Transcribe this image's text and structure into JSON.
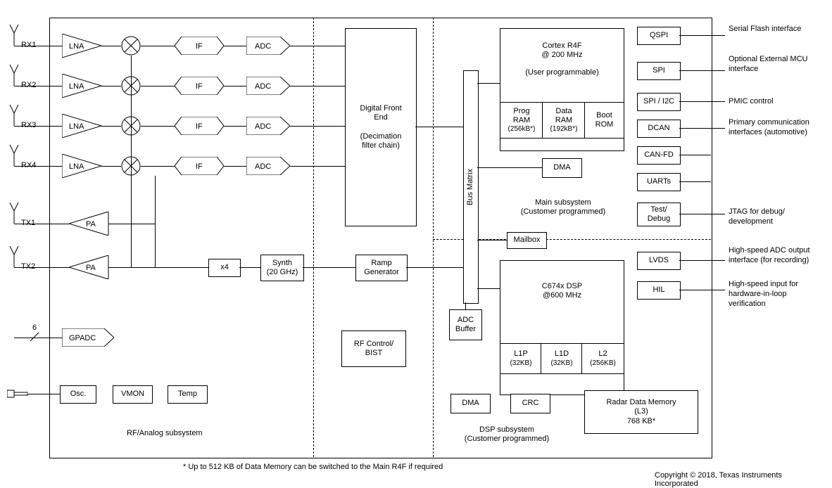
{
  "rx": {
    "rx1": "RX1",
    "rx2": "RX2",
    "rx3": "RX3",
    "rx4": "RX4"
  },
  "tx": {
    "tx1": "TX1",
    "tx2": "TX2"
  },
  "blocks": {
    "lna": "LNA",
    "if": "IF",
    "adc": "ADC",
    "pa": "PA",
    "x4": "x4",
    "synth1": "Synth",
    "synth2": "(20 GHz)",
    "ramp1": "Ramp",
    "ramp2": "Generator",
    "dfe1": "Digital Front",
    "dfe2": "End",
    "dfe3": "(Decimation",
    "dfe4": "filter chain)",
    "gpadc": "GPADC",
    "osc": "Osc.",
    "vmon": "VMON",
    "temp": "Temp",
    "rfctl1": "RF Control/",
    "rfctl2": "BIST",
    "bus1": "Bus Matrix",
    "adcbuf1": "ADC",
    "adcbuf2": "Buffer",
    "cortex1": "Cortex R4F",
    "cortex2": "@ 200 MHz",
    "cortex3": "(User programmable)",
    "program1": "Prog",
    "program2": "RAM",
    "program3": "(256kB*)",
    "dataram1": "Data",
    "dataram2": "RAM",
    "dataram3": "(192kB*)",
    "bootrom1": "Boot",
    "bootrom2": "ROM",
    "dma": "DMA",
    "mailbox": "Mailbox",
    "dsp1": "C674x DSP",
    "dsp2": "@600 MHz",
    "l1p1": "L1P",
    "l1p2": "(32KB)",
    "l1d1": "L1D",
    "l1d2": "(32KB)",
    "l21": "L2",
    "l22": "(256KB)",
    "crc": "CRC",
    "radar1": "Radar Data Memory",
    "radar2": "(L3)",
    "radar3": "768 KB*",
    "qspi": "QSPI",
    "spi": "SPI",
    "spii2c": "SPI / I2C",
    "dcan": "DCAN",
    "canfd": "CAN-FD",
    "uarts": "UARTs",
    "test1": "Test/",
    "test2": "Debug",
    "lvds": "LVDS",
    "hil": "HIL"
  },
  "sections": {
    "rfanalog": "RF/Analog subsystem",
    "main1": "Main subsystem",
    "main2": "(Customer programmed)",
    "dsp1": "DSP subsystem",
    "dsp2": "(Customer programmed)"
  },
  "annotations": {
    "qspi": "Serial Flash interface",
    "spi": "Optional External MCU interface",
    "spii2c": "PMIC control",
    "dcan": "Primary communication interfaces (automotive)",
    "test": "JTAG for debug/ development",
    "lvds": "High-speed ADC output interface (for recording)",
    "hil": "High-speed input for hardware-in-loop verification"
  },
  "gpadc_count": "6",
  "footnote": "* Up to 512 KB of Data Memory can be switched to the Main R4F if required",
  "copyright": "Copyright © 2018, Texas Instruments Incorporated"
}
